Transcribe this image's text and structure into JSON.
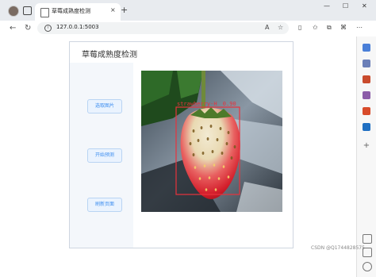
{
  "browser": {
    "tab_title": "草莓成熟度检测",
    "url": "127.0.0.1:5003",
    "tab_close": "×",
    "new_tab": "+",
    "window_controls": {
      "minimize": "—",
      "maximize": "☐",
      "close": "✕"
    },
    "nav": {
      "back": "←",
      "reload": "↻"
    },
    "toolbar_icons": [
      "read-aloud-icon",
      "favorite-star-icon",
      "split-screen-icon",
      "favorites-icon",
      "collections-icon",
      "extensions-icon",
      "more-icon"
    ]
  },
  "app": {
    "title": "草莓成熟度检测",
    "buttons": {
      "select_image": "选取图片",
      "start_detect": "开始预测",
      "refresh": "刷新页面"
    },
    "detection": {
      "label": "strawberry-H",
      "score": "0.90",
      "box_color": "#e8323c"
    }
  },
  "sidebar": {
    "icons": [
      "search-icon",
      "shopping-tag-icon",
      "tools-icon",
      "people-icon",
      "office-icon",
      "outlook-icon",
      "add-icon"
    ],
    "bottom_icons": [
      "layout-icon",
      "external-icon",
      "settings-icon"
    ]
  },
  "watermark": "CSDN @Q1744828575"
}
